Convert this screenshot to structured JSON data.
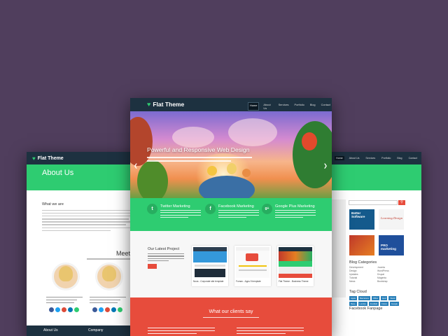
{
  "brand": {
    "name": "Flat Theme"
  },
  "left_page": {
    "hero_title": "About Us",
    "section_title": "What we are",
    "meet_title": "Meet th",
    "footer": [
      "About Us",
      "Company"
    ]
  },
  "center_page": {
    "nav": [
      "Home",
      "About Us",
      "Services",
      "Portfolio",
      "Blog",
      "Contact"
    ],
    "slider_caption": "Powerful and Responsive Web Design",
    "features": [
      {
        "icon": "twitter-icon",
        "glyph": "t",
        "title": "Twitter Marketing"
      },
      {
        "icon": "facebook-icon",
        "glyph": "f",
        "title": "Facebook Marketing"
      },
      {
        "icon": "google-plus-icon",
        "glyph": "g+",
        "title": "Google Plus Marketing"
      }
    ],
    "projects_title": "Our Latest Project",
    "project_captions": [
      "Nova - Corporate site template",
      "Fornax - Apps 5 template",
      "Flat Theme - Business Theme"
    ],
    "clients_title": "What our clients say"
  },
  "right_page": {
    "nav": [
      "Home",
      "About Us",
      "Services",
      "Portfolio",
      "Blog",
      "Contact"
    ],
    "ads": [
      {
        "label": "Better Software"
      },
      {
        "label": "Learning Design"
      },
      {
        "label": ""
      },
      {
        "label": "PRO marketing"
      }
    ],
    "blog_categories_title": "Blog Categories",
    "categories": [
      "Development",
      "Design",
      "Updates",
      "Tutorial",
      "News",
      "Joomla",
      "WordPress",
      "Drupal",
      "Magento",
      "Bootstrap"
    ],
    "tag_cloud_title": "Tag Cloud",
    "tags": [
      "Apple",
      "Barcelona",
      "Office",
      "Ipod",
      "Stock",
      "Race",
      "London",
      "Football",
      "Colors",
      "Google"
    ],
    "facebook_title": "Facebook Fanpage"
  },
  "colors": {
    "background": "#503e5d",
    "navbar": "#1d3140",
    "green": "#2ecc71",
    "red": "#e74c3c"
  }
}
